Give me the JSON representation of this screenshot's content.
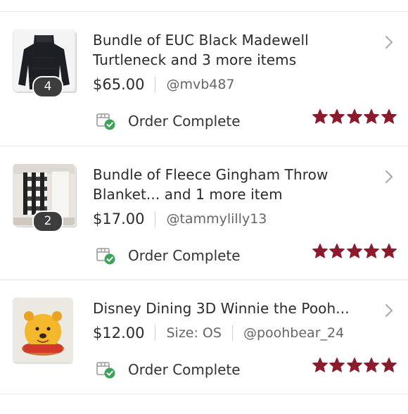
{
  "colors": {
    "star": "#8b1a2c",
    "check": "#3aa55a",
    "badge": "#3d3d3d",
    "divider": "#e4e4e4"
  },
  "orders": [
    {
      "title_line1": "Bundle of EUC Black Madewell",
      "title_line2": "Turtleneck and 3 more items",
      "price": "$65.00",
      "size": "",
      "seller": "@mvb487",
      "bundle_count": "4",
      "status": "Order Complete",
      "rating": 5,
      "thumb_icon": "black-turtleneck-photo"
    },
    {
      "title_line1": "Bundle of Fleece Gingham Throw",
      "title_line2": "Blanket... and 1 more item",
      "price": "$17.00",
      "size": "",
      "seller": "@tammylilly13",
      "bundle_count": "2",
      "status": "Order Complete",
      "rating": 5,
      "thumb_icon": "gingham-blanket-photo"
    },
    {
      "title_line1": "Disney Dining 3D Winnie the Pooh...",
      "title_line2": "",
      "price": "$12.00",
      "size": "Size: OS",
      "seller": "@poohbear_24",
      "bundle_count": "",
      "status": "Order Complete",
      "rating": 5,
      "thumb_icon": "winnie-the-pooh-mug-photo"
    }
  ]
}
